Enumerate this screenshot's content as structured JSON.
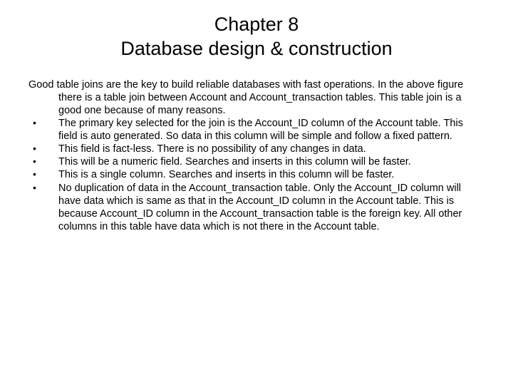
{
  "title": {
    "line1": "Chapter 8",
    "line2": "Database design & construction"
  },
  "intro": "Good table joins are the key to build reliable databases with fast operations. In the above figure there is a table join between Account and Account_transaction tables. This table join is a good one because of many reasons.",
  "bullets": [
    "The primary key selected for the join is the Account_ID column of the Account table. This field is auto generated. So data in this column will be simple and follow a fixed pattern.",
    "This field is fact-less. There is no possibility of any changes in data.",
    "This will be a numeric field. Searches and inserts in this column will be faster.",
    "This is a single column. Searches and inserts in this column will be faster.",
    "No duplication of data in the Account_transaction table. Only the Account_ID column will have data which is same as that in the Account_ID column in the Account table. This is because Account_ID column in the Account_transaction table is the foreign key. All other columns in this table have data which is not there in the Account table."
  ],
  "bullet_char": "•"
}
